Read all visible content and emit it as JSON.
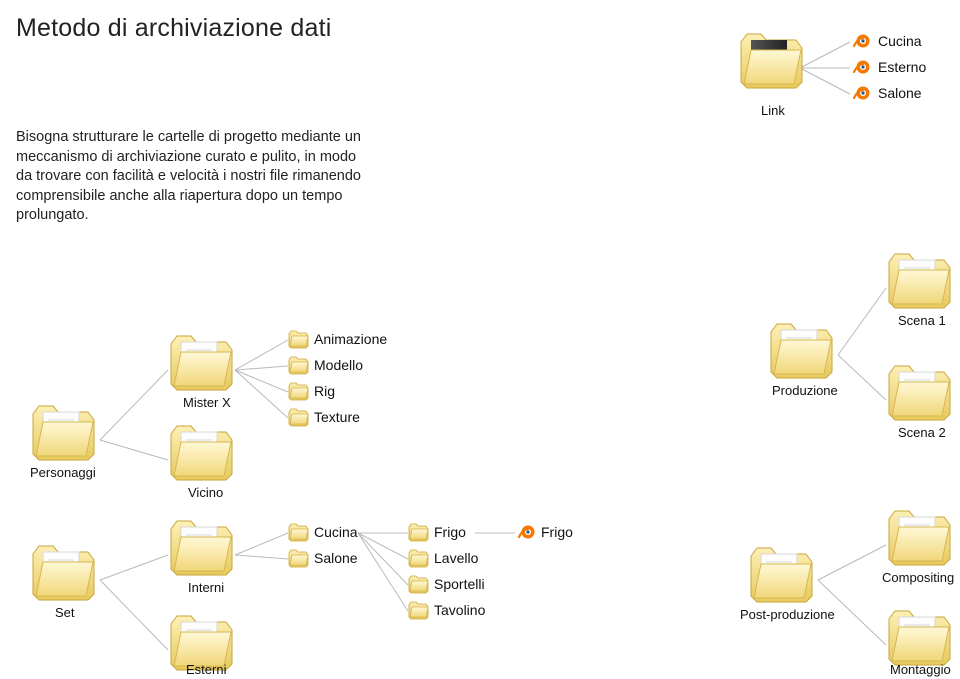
{
  "title": "Metodo di archiviazione dati",
  "paragraph": "Bisogna strutturare le cartelle di progetto mediante un meccanismo di archiviazione curato e pulito, in modo da trovare con facilità e velocità i nostri file rimanendo comprensibile anche alla riapertura dopo un tempo prolungato.",
  "topRight": {
    "linkLabel": "Link",
    "items": [
      "Cucina",
      "Esterno",
      "Salone"
    ]
  },
  "characters": {
    "root": "Personaggi",
    "children": [
      "Mister X",
      "Vicino"
    ],
    "leafList": [
      "Animazione",
      "Modello",
      "Rig",
      "Texture"
    ]
  },
  "set": {
    "root": "Set",
    "children": [
      "Interni",
      "Esterni"
    ],
    "rooms": [
      "Cucina",
      "Salone"
    ],
    "kitchenItems": [
      "Frigo",
      "Lavello",
      "Sportelli",
      "Tavolino"
    ],
    "blendFile": "Frigo"
  },
  "production": {
    "root": "Produzione",
    "scenes": [
      "Scena 1",
      "Scena 2"
    ]
  },
  "post": {
    "root": "Post-produzione",
    "children": [
      "Compositing",
      "Montaggio"
    ]
  }
}
